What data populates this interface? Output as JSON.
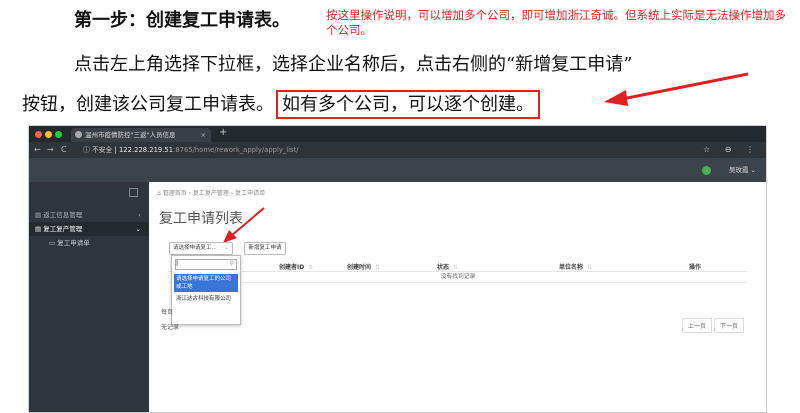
{
  "doc": {
    "step_title": "第一步：创建复工申请表。",
    "note": "按这里操作说明，可以增加多个公司，即可增加浙江奇诚。但系统上实际是无法操作增加多个公司。",
    "para1": "点击左上角选择下拉框，选择企业名称后，点击右侧的“新增复工申请”",
    "para2_prefix": "按钮，创建该公司复工申请表。",
    "para2_highlight": "如有多个公司，可以逐个创建。",
    "accent_color": "#e02020"
  },
  "browser": {
    "tab_title": "温州市疫情防控\"三返\"人员信息",
    "tab_close": "×",
    "new_tab": "+",
    "nav_back": "←",
    "nav_forward": "→",
    "nav_reload": "C",
    "security": "ⓘ 不安全",
    "url_host": "122.228.219.51",
    "url_path": ":8765/home/rework_apply/apply_list/",
    "addr_icons": "☆ ⊖ ⋮"
  },
  "app": {
    "user_name": "吴玫霞 ⌄",
    "sidebar": {
      "items": [
        {
          "label": "▤ 返工信息管理",
          "caret": "‹"
        },
        {
          "label": "▤ 复工复产管理",
          "caret": "⌄"
        },
        {
          "label": "▭ 复工申请单"
        }
      ]
    },
    "breadcrumb": "⌂ 管理首页 › 复工复产管理 › 复工申请单",
    "page_title": "复工申请列表",
    "select_placeholder": "请选择申请复工...",
    "select_caret": "⌄",
    "add_button": "新增复工申请",
    "table": {
      "columns": [
        "",
        "创建者ID",
        "创建时间",
        "状态",
        "单位名称",
        "操作"
      ],
      "empty_text": "没有找到记录"
    },
    "dropdown": {
      "search_value": "|",
      "search_icon": "⚲",
      "options": [
        "请选择申请复工的公司或工地",
        "浙江达古科技有限公司"
      ]
    },
    "per_page": "每页",
    "no_record": "无记录",
    "pager": {
      "prev": "上一页",
      "next": "下一页"
    }
  }
}
